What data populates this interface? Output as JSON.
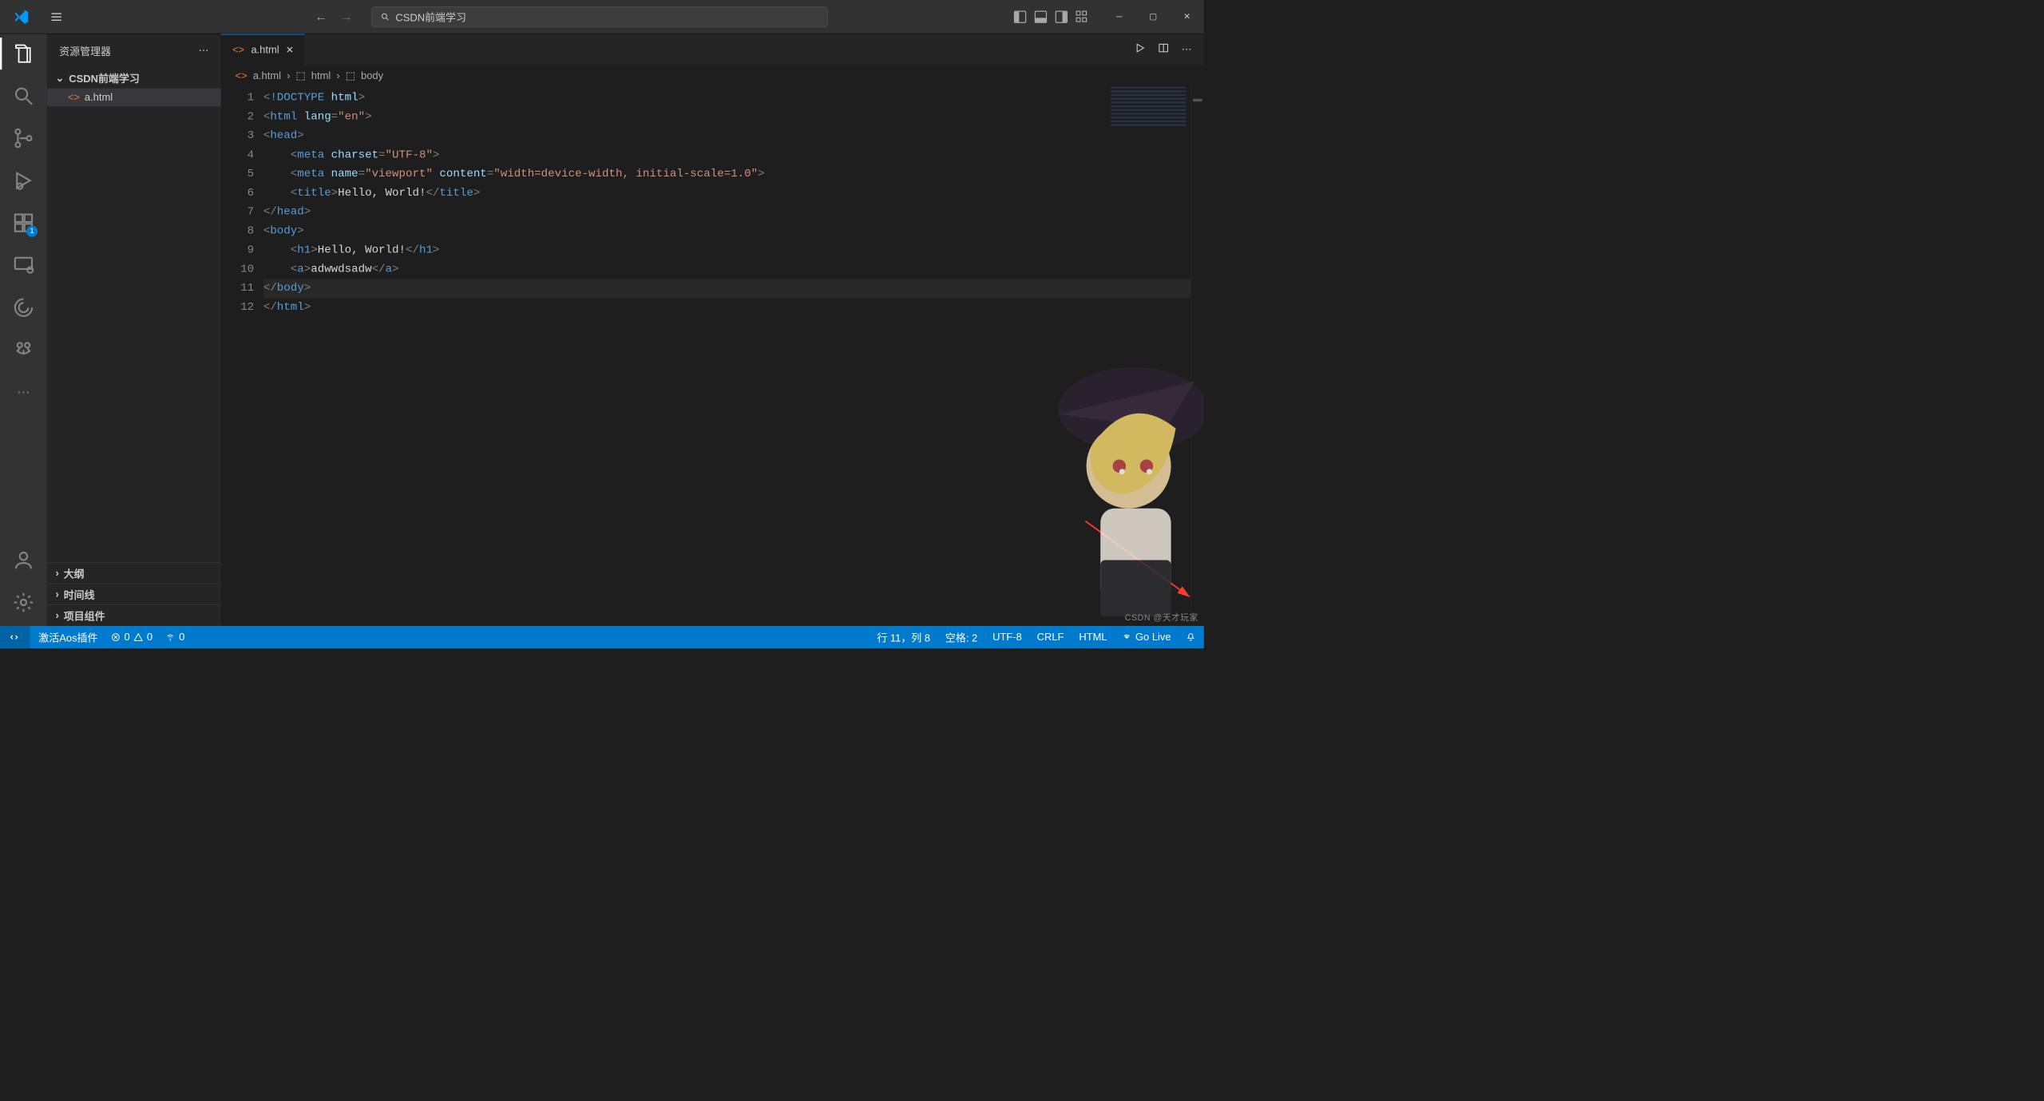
{
  "titlebar": {
    "search_placeholder": "CSDN前端学习"
  },
  "sidebar": {
    "title": "资源管理器",
    "folder": "CSDN前端学习",
    "file": "a.html",
    "sections": [
      "大纲",
      "时间线",
      "项目组件"
    ]
  },
  "activitybar": {
    "ext_badge": "1"
  },
  "tab": {
    "file": "a.html"
  },
  "breadcrumbs": {
    "file": "a.html",
    "path1": "html",
    "path2": "body"
  },
  "code": {
    "lines": [
      {
        "n": 1,
        "html": "<span class='punc'>&lt;</span><span class='doctype'>!DOCTYPE</span> <span class='attr'>html</span><span class='punc'>&gt;</span>"
      },
      {
        "n": 2,
        "html": "<span class='punc'>&lt;</span><span class='tag'>html</span> <span class='attr'>lang</span><span class='punc'>=</span><span class='str'>\"en\"</span><span class='punc'>&gt;</span>"
      },
      {
        "n": 3,
        "html": "<span class='punc'>&lt;</span><span class='tag'>head</span><span class='punc'>&gt;</span>"
      },
      {
        "n": 4,
        "html": "    <span class='punc'>&lt;</span><span class='tag'>meta</span> <span class='attr'>charset</span><span class='punc'>=</span><span class='str'>\"UTF-8\"</span><span class='punc'>&gt;</span>"
      },
      {
        "n": 5,
        "html": "    <span class='punc'>&lt;</span><span class='tag'>meta</span> <span class='attr'>name</span><span class='punc'>=</span><span class='str'>\"viewport\"</span> <span class='attr'>content</span><span class='punc'>=</span><span class='str'>\"width=device-width, initial-scale=1.0\"</span><span class='punc'>&gt;</span>"
      },
      {
        "n": 6,
        "html": "    <span class='punc'>&lt;</span><span class='tag'>title</span><span class='punc'>&gt;</span><span class='text'>Hello, World!</span><span class='punc'>&lt;/</span><span class='tag'>title</span><span class='punc'>&gt;</span>"
      },
      {
        "n": 7,
        "html": "<span class='punc'>&lt;/</span><span class='tag'>head</span><span class='punc'>&gt;</span>"
      },
      {
        "n": 8,
        "html": "<span class='punc'>&lt;</span><span class='tag'>body</span><span class='punc'>&gt;</span>"
      },
      {
        "n": 9,
        "html": "    <span class='punc'>&lt;</span><span class='tag'>h1</span><span class='punc'>&gt;</span><span class='text'>Hello, World!</span><span class='punc'>&lt;/</span><span class='tag'>h1</span><span class='punc'>&gt;</span>"
      },
      {
        "n": 10,
        "html": "    <span class='punc'>&lt;</span><span class='tag'>a</span><span class='punc'>&gt;</span><span class='text'>adwwdsadw</span><span class='punc'>&lt;/</span><span class='tag'>a</span><span class='punc'>&gt;</span>"
      },
      {
        "n": 11,
        "html": "<span class='punc'>&lt;/</span><span class='tag'>body</span><span class='punc'>&gt;</span>",
        "hl": true
      },
      {
        "n": 12,
        "html": "<span class='punc'>&lt;/</span><span class='tag'>html</span><span class='punc'>&gt;</span>"
      }
    ]
  },
  "statusbar": {
    "aos": "激活Aos插件",
    "errors": "0",
    "warnings": "0",
    "port": "0",
    "cursor": "行 11，列 8",
    "spaces": "空格: 2",
    "encoding": "UTF-8",
    "eol": "CRLF",
    "lang": "HTML",
    "golive": "Go Live"
  },
  "watermark": "CSDN @天才玩家"
}
